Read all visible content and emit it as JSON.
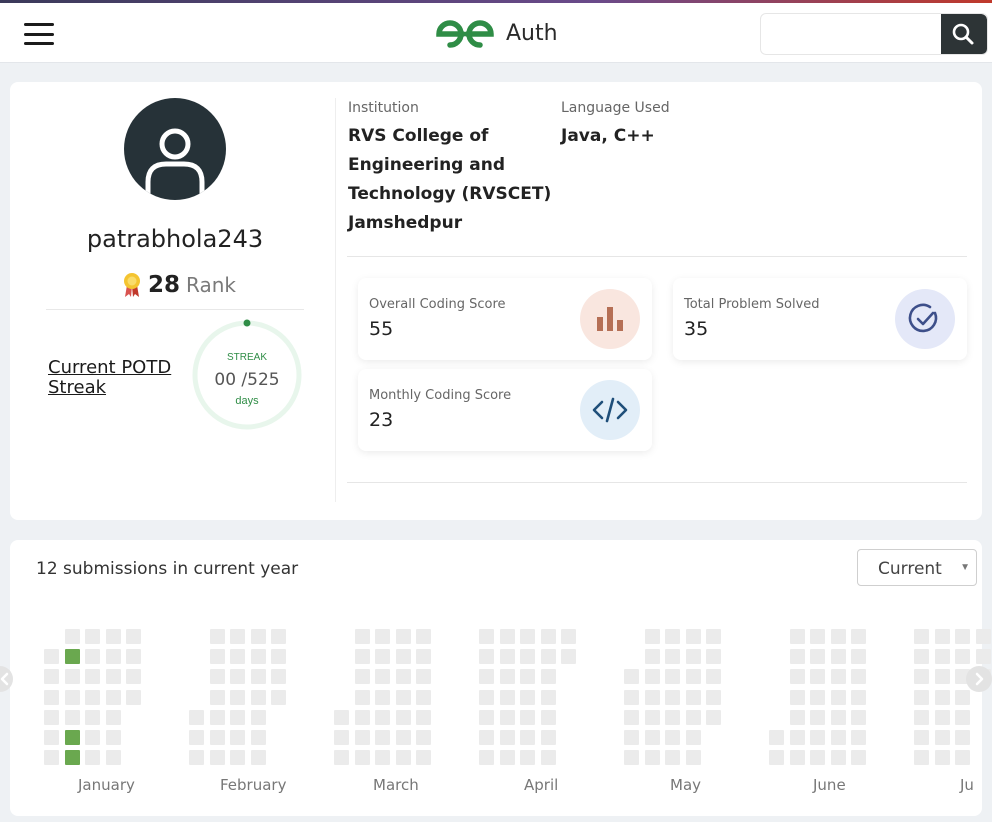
{
  "header": {
    "brand": "Auth",
    "search_placeholder": ""
  },
  "profile": {
    "username": "patrabhola243",
    "rank_value": "28",
    "rank_label": "Rank",
    "potd_label": "Current POTD Streak",
    "streak": {
      "label": "STREAK",
      "current": "00",
      "total": "/525",
      "unit": "days"
    },
    "institution_label": "Institution",
    "institution_lines": [
      "RVS College of",
      "Engineering and",
      "Technology (RVSCET)",
      "Jamshedpur"
    ],
    "language_label": "Language Used",
    "languages": "Java, C++"
  },
  "stats": {
    "overall_label": "Overall Coding Score",
    "overall_value": "55",
    "problems_label": "Total Problem Solved",
    "problems_value": "35",
    "monthly_label": "Monthly Coding Score",
    "monthly_value": "23"
  },
  "submissions": {
    "summary": "12 submissions in current year",
    "dropdown_selected": "Current",
    "months": [
      "January",
      "February",
      "March",
      "April",
      "May",
      "June",
      "Ju"
    ]
  },
  "colors": {
    "brand_green": "#2f8d46",
    "heat_empty": "#ebebeb",
    "heat_active": "#6aa84f",
    "search_button": "#2d3436"
  },
  "icons": {
    "menu": "hamburger-menu-icon",
    "search": "search-icon",
    "avatar": "user-avatar-icon",
    "rank": "medal-icon",
    "overall": "bar-chart-icon",
    "problems": "check-circle-icon",
    "monthly": "code-icon",
    "prev": "chevron-left-icon",
    "next": "chevron-right-icon"
  }
}
